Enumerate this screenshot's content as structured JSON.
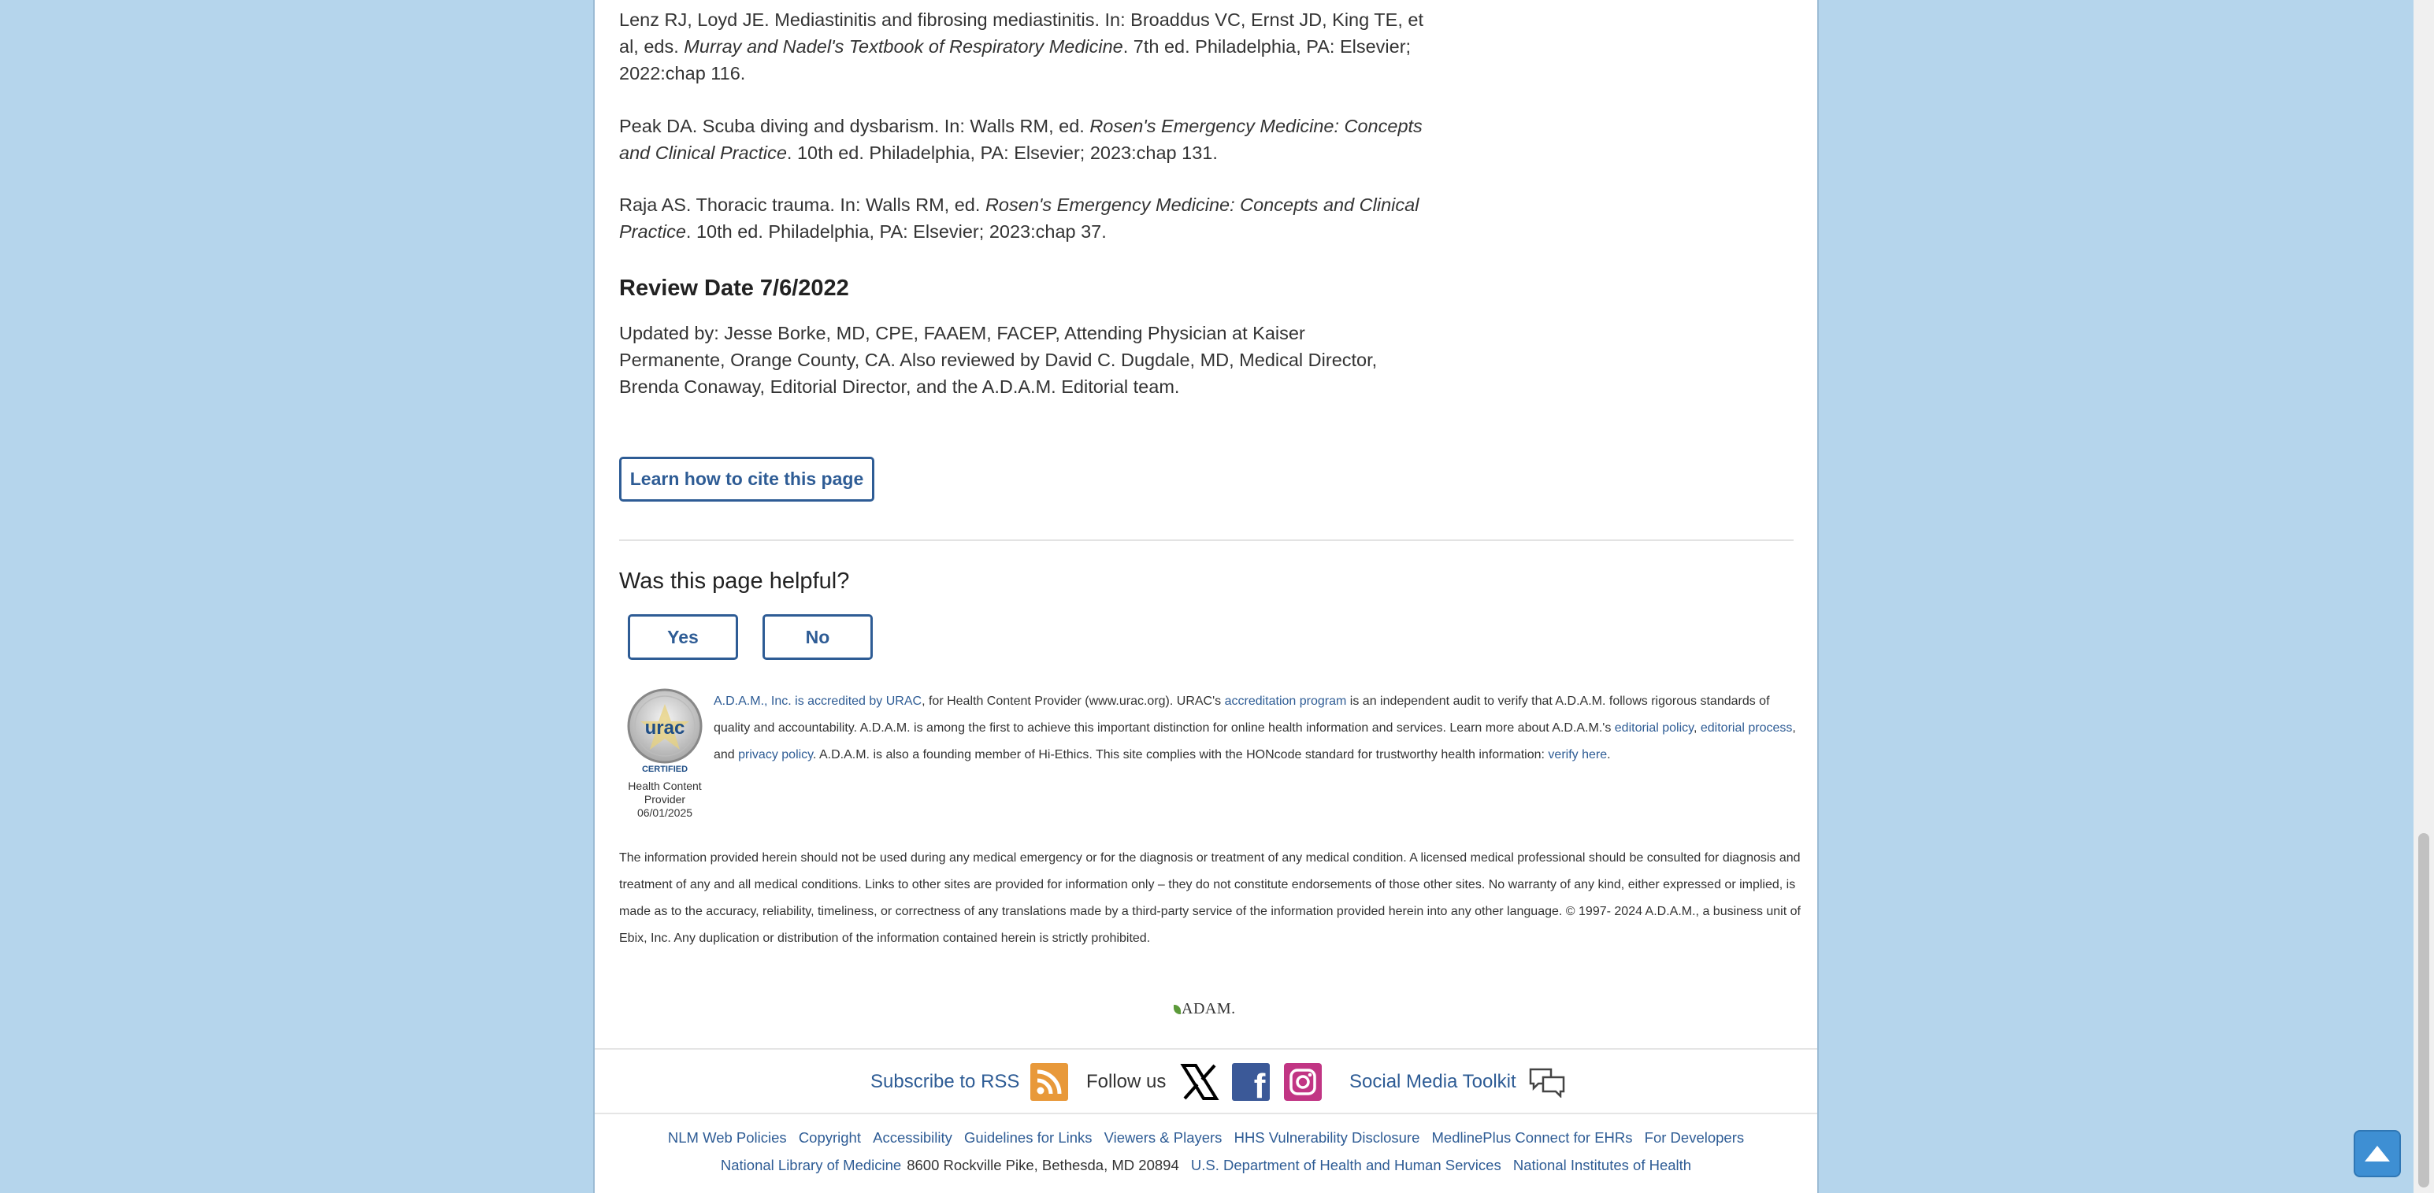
{
  "references": [
    {
      "pre": "Lenz RJ, Loyd JE. Mediastinitis and fibrosing mediastinitis. In: Broaddus VC, Ernst JD, King TE, et al, eds. ",
      "title": "Murray and Nadel's Textbook of Respiratory Medicine",
      "post": ". 7th ed. Philadelphia, PA: Elsevier; 2022:chap 116."
    },
    {
      "pre": "Peak DA. Scuba diving and dysbarism. In: Walls RM, ed. ",
      "title": "Rosen's Emergency Medicine: Concepts and Clinical Practice",
      "post": ". 10th ed. Philadelphia, PA: Elsevier; 2023:chap 131."
    },
    {
      "pre": "Raja AS. Thoracic trauma. In: Walls RM, ed. ",
      "title": "Rosen's Emergency Medicine: Concepts and Clinical Practice",
      "post": ". 10th ed. Philadelphia, PA: Elsevier; 2023:chap 37."
    }
  ],
  "review": {
    "heading": "Review Date 7/6/2022",
    "updated": "Updated by: Jesse Borke, MD, CPE, FAAEM, FACEP, Attending Physician at Kaiser Permanente, Orange County, CA. Also reviewed by David C. Dugdale, MD, Medical Director, Brenda Conaway, Editorial Director, and the A.D.A.M. Editorial team."
  },
  "cite_button": "Learn how to cite this page",
  "feedback": {
    "question": "Was this page helpful?",
    "yes": "Yes",
    "no": "No"
  },
  "urac": {
    "seal_text": "urac",
    "seal_certified": "CERTIFIED",
    "caption_1": "Health Content",
    "caption_2": "Provider",
    "caption_3": "06/01/2025",
    "link_accredited": "A.D.A.M., Inc. is accredited by URAC",
    "text_1": ", for Health Content Provider (www.urac.org). URAC's ",
    "link_program": "accreditation program",
    "text_2": " is an independent audit to verify that A.D.A.M. follows rigorous standards of quality and accountability. A.D.A.M. is among the first to achieve this important distinction for online health information and services. Learn more about A.D.A.M.'s ",
    "link_editorial_policy": "editorial policy",
    "text_3": ", ",
    "link_editorial_process": "editorial process",
    "text_4": ", and ",
    "link_privacy": "privacy policy",
    "text_5": ". A.D.A.M. is also a founding member of Hi-Ethics. This site complies with the HONcode standard for trustworthy health information: ",
    "link_verify": "verify here",
    "text_6": "."
  },
  "disclaimer": "The information provided herein should not be used during any medical emergency or for the diagnosis or treatment of any medical condition. A licensed medical professional should be consulted for diagnosis and treatment of any and all medical conditions. Links to other sites are provided for information only – they do not constitute endorsements of those other sites. No warranty of any kind, either expressed or implied, is made as to the accuracy, reliability, timeliness, or correctness of any translations made by a third-party service of the information provided herein into any other language. © 1997- 2024 A.D.A.M., a business unit of Ebix, Inc. Any duplication or distribution of the information contained herein is strictly prohibited.",
  "adam_logo": "ADAM.",
  "social": {
    "rss": "Subscribe to RSS",
    "follow": "Follow us",
    "toolkit": "Social Media Toolkit"
  },
  "footer_links": [
    "NLM Web Policies",
    "Copyright",
    "Accessibility",
    "Guidelines for Links",
    "Viewers & Players",
    "HHS Vulnerability Disclosure",
    "MedlinePlus Connect for EHRs",
    "For Developers"
  ],
  "footer_address": {
    "nlm": "National Library of Medicine",
    "address": "8600 Rockville Pike, Bethesda, MD 20894",
    "hhs": "U.S. Department of Health and Human Services",
    "nih": "National Institutes of Health"
  },
  "colors": {
    "link": "#2e5c95",
    "background": "#b5d5ec",
    "rss": "#e8993a",
    "facebook": "#3b5998",
    "instagram": "#c13584"
  }
}
